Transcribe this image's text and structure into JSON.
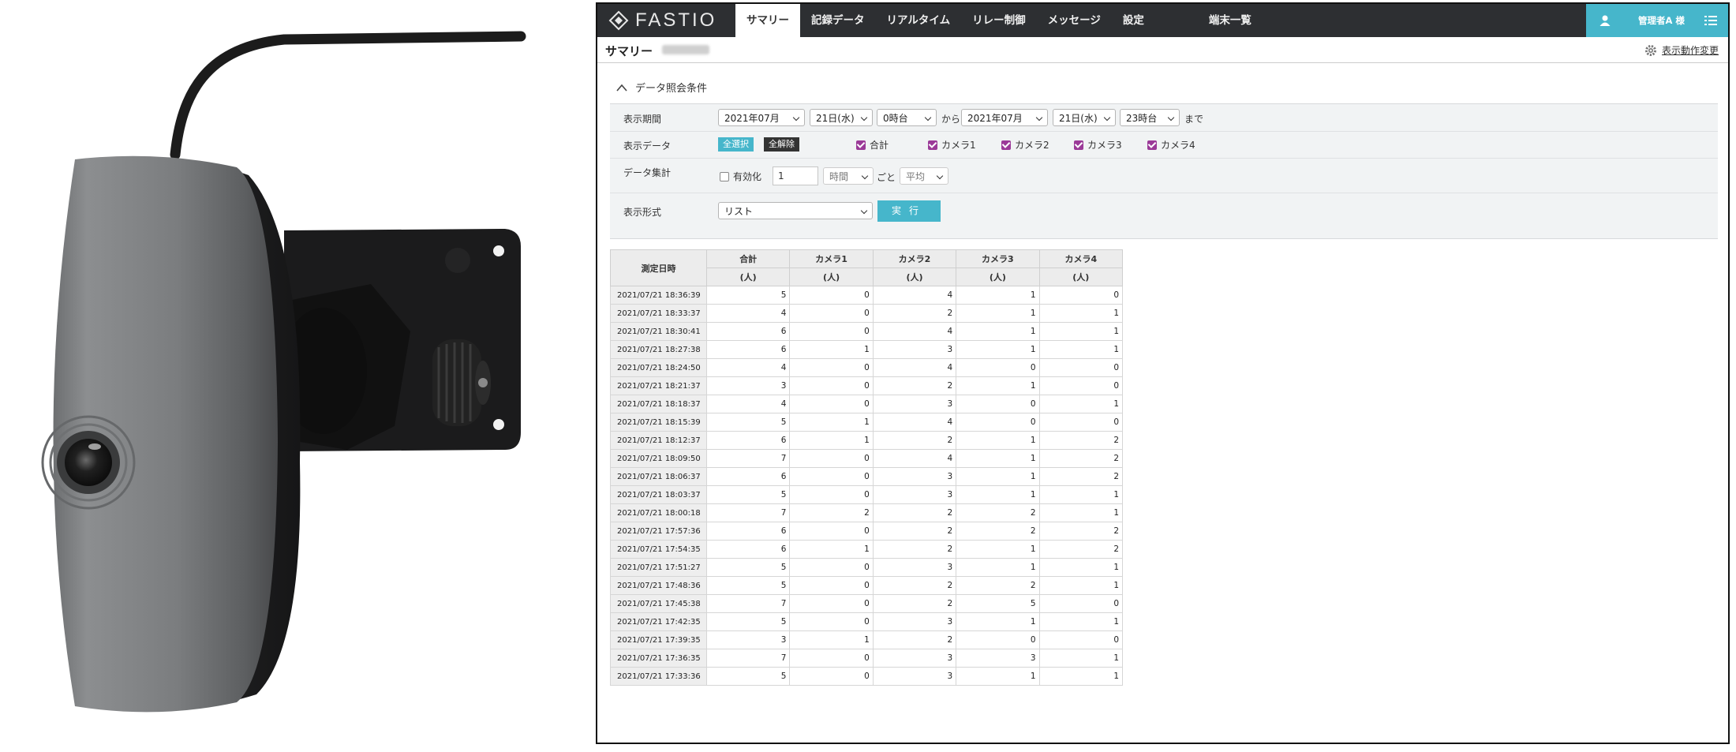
{
  "app": {
    "logo": "FASTIO",
    "nav": [
      "サマリー",
      "記録データ",
      "リアルタイム",
      "リレー制御",
      "メッセージ",
      "設定",
      "端末一覧"
    ],
    "active_nav": "サマリー",
    "user": "管理者A 様"
  },
  "subheader": {
    "title": "サマリー",
    "display_change": "表示動作変更"
  },
  "conditions": {
    "title": "データ照会条件",
    "period_label": "表示期間",
    "from_month": "2021年07月",
    "from_day": "21日(水)",
    "from_hour": "0時台",
    "from_word": "から",
    "to_month": "2021年07月",
    "to_day": "21日(水)",
    "to_hour": "23時台",
    "to_word": "まで",
    "data_label": "表示データ",
    "select_all": "全選択",
    "clear_all": "全解除",
    "checks": [
      "合計",
      "カメラ1",
      "カメラ2",
      "カメラ3",
      "カメラ4"
    ],
    "agg_label": "データ集計",
    "enable_label": "有効化",
    "agg_value": "1",
    "agg_unit": "時間",
    "agg_each": "ごと",
    "agg_method": "平均",
    "format_label": "表示形式",
    "format_value": "リスト",
    "run_button": "実行"
  },
  "table": {
    "dt_header": "測定日時",
    "columns": [
      "合計",
      "カメラ1",
      "カメラ2",
      "カメラ3",
      "カメラ4"
    ],
    "unit": "(人)",
    "rows": [
      [
        "2021/07/21 18:36:39",
        5,
        0,
        4,
        1,
        0
      ],
      [
        "2021/07/21 18:33:37",
        4,
        0,
        2,
        1,
        1
      ],
      [
        "2021/07/21 18:30:41",
        6,
        0,
        4,
        1,
        1
      ],
      [
        "2021/07/21 18:27:38",
        6,
        1,
        3,
        1,
        1
      ],
      [
        "2021/07/21 18:24:50",
        4,
        0,
        4,
        0,
        0
      ],
      [
        "2021/07/21 18:21:37",
        3,
        0,
        2,
        1,
        0
      ],
      [
        "2021/07/21 18:18:37",
        4,
        0,
        3,
        0,
        1
      ],
      [
        "2021/07/21 18:15:39",
        5,
        1,
        4,
        0,
        0
      ],
      [
        "2021/07/21 18:12:37",
        6,
        1,
        2,
        1,
        2
      ],
      [
        "2021/07/21 18:09:50",
        7,
        0,
        4,
        1,
        2
      ],
      [
        "2021/07/21 18:06:37",
        6,
        0,
        3,
        1,
        2
      ],
      [
        "2021/07/21 18:03:37",
        5,
        0,
        3,
        1,
        1
      ],
      [
        "2021/07/21 18:00:18",
        7,
        2,
        2,
        2,
        1
      ],
      [
        "2021/07/21 17:57:36",
        6,
        0,
        2,
        2,
        2
      ],
      [
        "2021/07/21 17:54:35",
        6,
        1,
        2,
        1,
        2
      ],
      [
        "2021/07/21 17:51:27",
        5,
        0,
        3,
        1,
        1
      ],
      [
        "2021/07/21 17:48:36",
        5,
        0,
        2,
        2,
        1
      ],
      [
        "2021/07/21 17:45:38",
        7,
        0,
        2,
        5,
        0
      ],
      [
        "2021/07/21 17:42:35",
        5,
        0,
        3,
        1,
        1
      ],
      [
        "2021/07/21 17:39:35",
        3,
        1,
        2,
        0,
        0
      ],
      [
        "2021/07/21 17:36:35",
        7,
        0,
        3,
        3,
        1
      ],
      [
        "2021/07/21 17:33:36",
        5,
        0,
        3,
        1,
        1
      ]
    ]
  },
  "colors": {
    "topbar": "#2d2f32",
    "accent": "#46b6cb",
    "checkbox": "#9b3a98",
    "clear_button": "#333333"
  }
}
